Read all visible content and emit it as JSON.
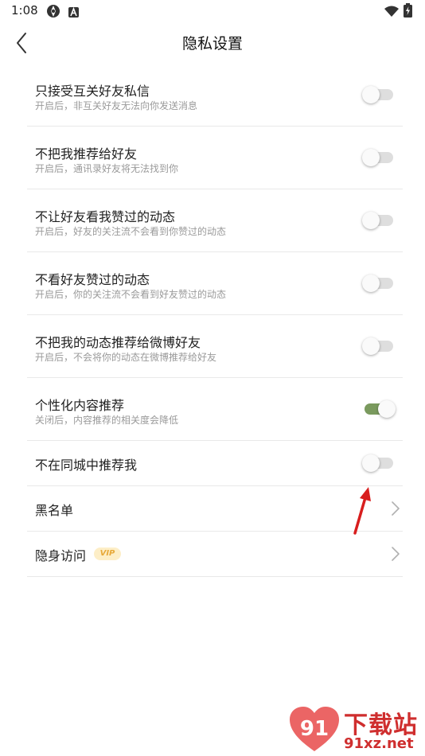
{
  "status_bar": {
    "time": "1:08",
    "left_icons": [
      "tor-icon",
      "a-icon"
    ],
    "right_icons": [
      "wifi-icon",
      "battery-charging-icon"
    ]
  },
  "header": {
    "title": "隐私设置",
    "back_icon": "chevron-left-icon"
  },
  "settings": [
    {
      "title": "只接受互关好友私信",
      "subtitle": "开启后，非互关好友无法向你发送消息",
      "type": "toggle",
      "on": false
    },
    {
      "title": "不把我推荐给好友",
      "subtitle": "开启后，通讯录好友将无法找到你",
      "type": "toggle",
      "on": false
    },
    {
      "title": "不让好友看我赞过的动态",
      "subtitle": "开启后，好友的关注流不会看到你赞过的动态",
      "type": "toggle",
      "on": false
    },
    {
      "title": "不看好友赞过的动态",
      "subtitle": "开启后，你的关注流不会看到好友赞过的动态",
      "type": "toggle",
      "on": false
    },
    {
      "title": "不把我的动态推荐给微博好友",
      "subtitle": "开启后，不会将你的动态在微博推荐给好友",
      "type": "toggle",
      "on": false
    },
    {
      "title": "个性化内容推荐",
      "subtitle": "关闭后，内容推荐的相关度会降低",
      "type": "toggle",
      "on": true
    },
    {
      "title": "不在同城中推荐我",
      "type": "toggle",
      "on": false
    },
    {
      "title": "黑名单",
      "type": "link"
    },
    {
      "title": "隐身访问",
      "badge": "VIP",
      "type": "link"
    }
  ],
  "colors": {
    "toggle_on": "#7a9a5e",
    "toggle_off": "#dedede",
    "annotation_arrow": "#d81e1e",
    "vip_badge_bg": "#fdeec7",
    "vip_badge_text": "#e7a93a",
    "watermark": "#cf2e2e"
  },
  "watermark": {
    "logo_text": "91",
    "title": "下载站",
    "url": "91xz.net"
  }
}
